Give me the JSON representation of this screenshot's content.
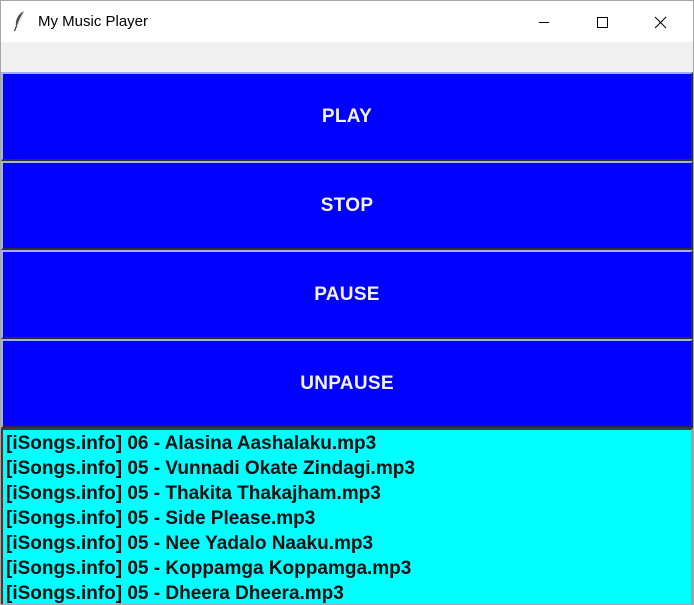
{
  "window": {
    "title": "My Music Player"
  },
  "title_controls": {
    "minimize_icon": "minimize-icon",
    "maximize_icon": "maximize-icon",
    "close_icon": "close-icon",
    "app_icon": "feather-icon"
  },
  "controls": {
    "play_label": "PLAY",
    "stop_label": "STOP",
    "pause_label": "PAUSE",
    "unpause_label": "UNPAUSE"
  },
  "playlist": {
    "songs": [
      "[iSongs.info] 06 - Alasina Aashalaku.mp3",
      "[iSongs.info] 05 - Vunnadi Okate Zindagi.mp3",
      "[iSongs.info] 05 - Thakita Thakajham.mp3",
      "[iSongs.info] 05 - Side Please.mp3",
      "[iSongs.info] 05 - Nee Yadalo Naaku.mp3",
      "[iSongs.info] 05 - Koppamga Koppamga.mp3",
      "[iSongs.info] 05 - Dheera Dheera.mp3"
    ]
  },
  "colors": {
    "button_bg": "#0000ff",
    "button_text": "#f2f2f2",
    "playlist_bg": "#00ffff",
    "window_bg": "#f0f0f0"
  }
}
